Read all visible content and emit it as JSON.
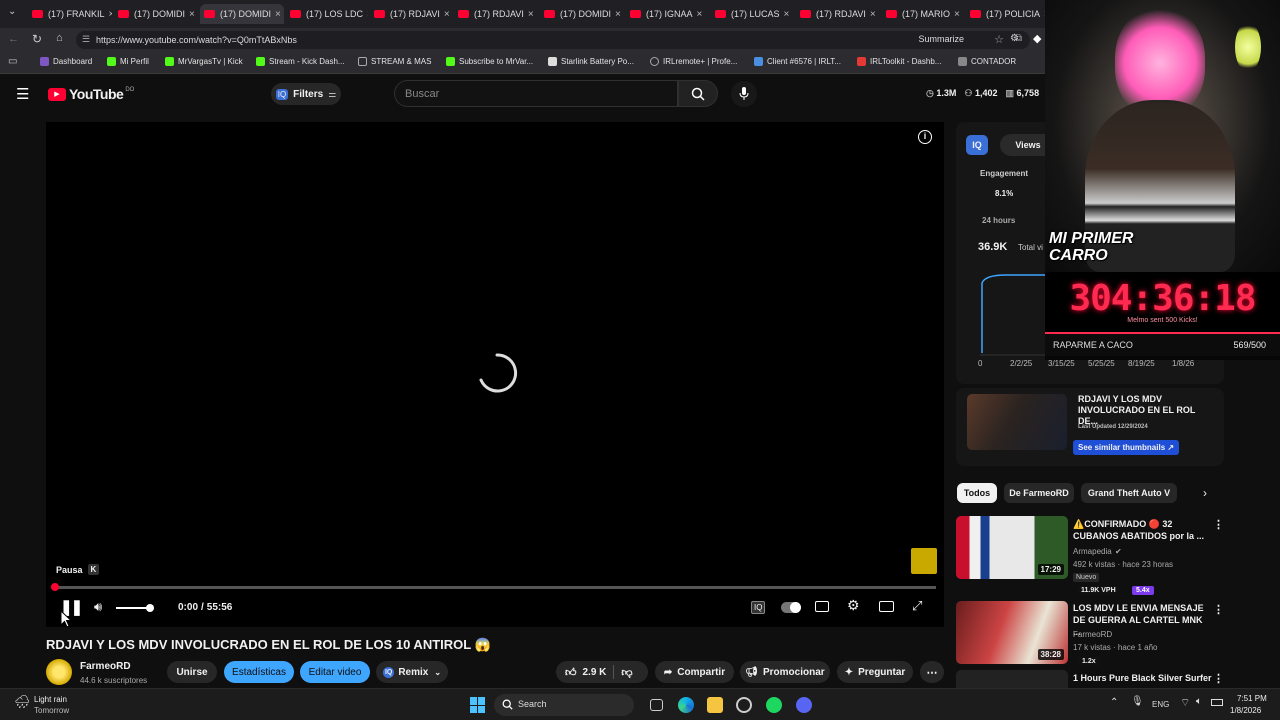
{
  "browser": {
    "tabs": [
      {
        "label": "(17) FRANKIL"
      },
      {
        "label": "(17) DOMIDI"
      },
      {
        "label": "(17) DOMIDI"
      },
      {
        "label": "(17) LOS LDC"
      },
      {
        "label": "(17) RDJAVI"
      },
      {
        "label": "(17) RDJAVI"
      },
      {
        "label": "(17) DOMIDI"
      },
      {
        "label": "(17) IGNAA"
      },
      {
        "label": "(17) LUCAS"
      },
      {
        "label": "(17) RDJAVI"
      },
      {
        "label": "(17) MARIO"
      },
      {
        "label": "(17) POLICIA"
      }
    ],
    "url": "https://www.youtube.com/watch?v=Q0mTtABxNbs",
    "summarize_label": "Summarize",
    "bookmarks": [
      {
        "label": "Dashboard",
        "color": "#7e57c2"
      },
      {
        "label": "Mi Perfil",
        "color": "#53fc18"
      },
      {
        "label": "MrVargasTv | Kick",
        "color": "#53fc18"
      },
      {
        "label": "Stream - Kick Dash...",
        "color": "#53fc18"
      },
      {
        "label": "STREAM & MAS",
        "color": "#888888"
      },
      {
        "label": "Subscribe to MrVar...",
        "color": "#53fc18"
      },
      {
        "label": "Starlink Battery Po...",
        "color": "#dddddd"
      },
      {
        "label": "IRLremote+ | Profe...",
        "color": "#888888"
      },
      {
        "label": "Client #6576 | IRLT...",
        "color": "#4a90e2"
      },
      {
        "label": "IRLToolkit - Dashb...",
        "color": "#e53935"
      },
      {
        "label": "CONTADOR",
        "color": "#888888"
      }
    ]
  },
  "youtube": {
    "logo": "YouTube",
    "logo_region": "DO",
    "filters_label": "Filters",
    "search_placeholder": "Buscar",
    "stats": {
      "views": "1.3M",
      "likes": "1,402",
      "count": "6,758"
    }
  },
  "player": {
    "tooltip_label": "Pausa",
    "tooltip_key": "K",
    "time_current": "0:00",
    "time_separator": "/",
    "time_total": "55:56",
    "volume_level": 0.75,
    "progress": 0.0
  },
  "video": {
    "title": "RDJAVI Y LOS MDV INVOLUCRADO EN EL ROL DE LOS 10 ANTIROL 😱",
    "channel": "FarmeoRD",
    "subscribers": "44.6 k suscriptores",
    "join_label": "Unirse",
    "stats_label": "Estadísticas",
    "edit_label": "Editar video",
    "remix_label": "Remix",
    "likes": "2.9 K",
    "share_label": "Compartir",
    "promote_label": "Promocionar",
    "ask_label": "Preguntar"
  },
  "vidiq": {
    "badge": "IQ",
    "views_tab": "Views",
    "engagement_label": "Engagement",
    "engagement_value": "8.1%",
    "period": "24 hours",
    "total_value": "36.9K",
    "total_label": "Total vi",
    "x_ticks": [
      "0",
      "2/2/25",
      "3/15/25",
      "5/25/25",
      "8/19/25",
      "1/8/26"
    ],
    "promo_title": "RDJAVI Y LOS MDV INVOLUCRADO EN EL ROL DE...",
    "promo_updated": "Last Updated 12/29/2024",
    "promo_button": "See similar thumbnails ↗"
  },
  "chips": [
    "Todos",
    "De FarmeoRD",
    "Grand Theft Auto V"
  ],
  "recommendations": [
    {
      "title": "⚠️CONFIRMADO 🔴 32 CUBANOS ABATIDOS por la ...",
      "channel": "Armapedia",
      "meta": "492 k vistas · hace 23 horas",
      "badge": "Nuevo",
      "vph": "11.9K VPH",
      "multiplier": "5.4x",
      "duration": "17:29"
    },
    {
      "title": "LOS MDV LE ENVIA MENSAJE DE GUERRA AL CARTEL MNK ...",
      "channel": "FarmeoRD",
      "meta": "17 k vistas · hace 1 año",
      "multiplier": "1.2x",
      "duration": "38:28"
    },
    {
      "title": "1 Hours Pure Black Silver Surfer",
      "channel": "",
      "meta": ""
    }
  ],
  "overlay": {
    "banner": "MI PRIMER CARRO",
    "timer": "304:36:18",
    "subtext": "Melmo sent 500 Kicks!",
    "goal_label": "RAPARME A CACO",
    "goal_value": "569/500"
  },
  "taskbar": {
    "weather": "Light rain",
    "weather_sub": "Tomorrow",
    "search_label": "Search",
    "language": "ENG",
    "time": "7:51 PM",
    "date": "1/8/2026"
  },
  "colors": {
    "accent": "#3ea6ff",
    "red": "#ff0033",
    "overlay_red": "#ff2a4f"
  }
}
